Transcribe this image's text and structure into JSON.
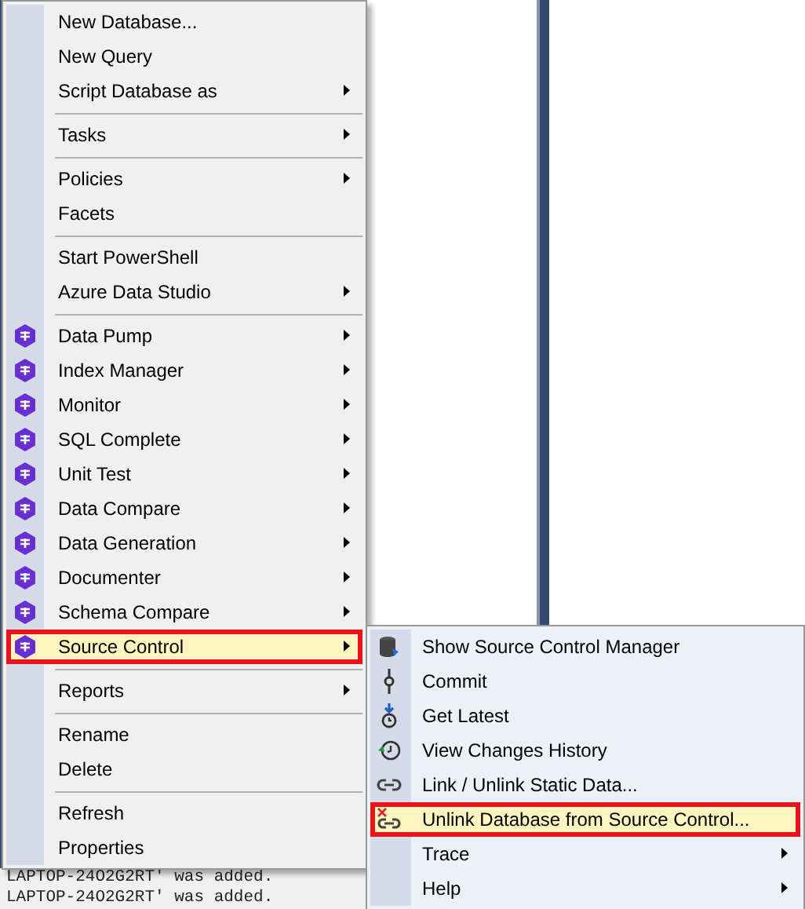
{
  "log_lines": [
    "LAPTOP-24O2G2RT' was added.",
    "LAPTOP-24O2G2RT' was added."
  ],
  "context_menu": {
    "items": [
      {
        "kind": "item",
        "label": "New Database...",
        "submenu": false,
        "selected": false
      },
      {
        "kind": "item",
        "label": "New Query",
        "submenu": false,
        "selected": false
      },
      {
        "kind": "item",
        "label": "Script Database as",
        "submenu": true,
        "selected": false
      },
      {
        "kind": "separator"
      },
      {
        "kind": "item",
        "label": "Tasks",
        "submenu": true,
        "selected": false
      },
      {
        "kind": "separator"
      },
      {
        "kind": "item",
        "label": "Policies",
        "submenu": true,
        "selected": false
      },
      {
        "kind": "item",
        "label": "Facets",
        "submenu": false,
        "selected": false
      },
      {
        "kind": "separator"
      },
      {
        "kind": "item",
        "label": "Start PowerShell",
        "submenu": false,
        "selected": false
      },
      {
        "kind": "item",
        "label": "Azure Data Studio",
        "submenu": true,
        "selected": false
      },
      {
        "kind": "separator"
      },
      {
        "kind": "tool",
        "label": "Data Pump",
        "submenu": true,
        "selected": false
      },
      {
        "kind": "tool",
        "label": "Index Manager",
        "submenu": true,
        "selected": false
      },
      {
        "kind": "tool",
        "label": "Monitor",
        "submenu": true,
        "selected": false
      },
      {
        "kind": "tool",
        "label": "SQL Complete",
        "submenu": true,
        "selected": false
      },
      {
        "kind": "tool",
        "label": "Unit Test",
        "submenu": true,
        "selected": false
      },
      {
        "kind": "tool",
        "label": "Data Compare",
        "submenu": true,
        "selected": false
      },
      {
        "kind": "tool",
        "label": "Data Generation",
        "submenu": true,
        "selected": false
      },
      {
        "kind": "tool",
        "label": "Documenter",
        "submenu": true,
        "selected": false
      },
      {
        "kind": "tool",
        "label": "Schema Compare",
        "submenu": true,
        "selected": false
      },
      {
        "kind": "tool",
        "label": "Source Control",
        "submenu": true,
        "selected": true
      },
      {
        "kind": "separator"
      },
      {
        "kind": "item",
        "label": "Reports",
        "submenu": true,
        "selected": false
      },
      {
        "kind": "separator"
      },
      {
        "kind": "item",
        "label": "Rename",
        "submenu": false,
        "selected": false
      },
      {
        "kind": "item",
        "label": "Delete",
        "submenu": false,
        "selected": false
      },
      {
        "kind": "separator"
      },
      {
        "kind": "item",
        "label": "Refresh",
        "submenu": false,
        "selected": false
      },
      {
        "kind": "item",
        "label": "Properties",
        "submenu": false,
        "selected": false
      }
    ]
  },
  "submenu": {
    "items": [
      {
        "kind": "database",
        "label": "Show Source Control Manager",
        "submenu": false,
        "selected": false
      },
      {
        "kind": "commit",
        "label": "Commit",
        "submenu": false,
        "selected": false
      },
      {
        "kind": "download",
        "label": "Get Latest",
        "submenu": false,
        "selected": false
      },
      {
        "kind": "history",
        "label": "View Changes History",
        "submenu": false,
        "selected": false
      },
      {
        "kind": "link",
        "label": "Link / Unlink Static Data...",
        "submenu": false,
        "selected": false
      },
      {
        "kind": "unlink",
        "label": "Unlink Database from Source Control...",
        "submenu": false,
        "selected": true
      },
      {
        "kind": "item",
        "label": "Trace",
        "submenu": true,
        "selected": false
      },
      {
        "kind": "item",
        "label": "Help",
        "submenu": true,
        "selected": false
      }
    ]
  }
}
